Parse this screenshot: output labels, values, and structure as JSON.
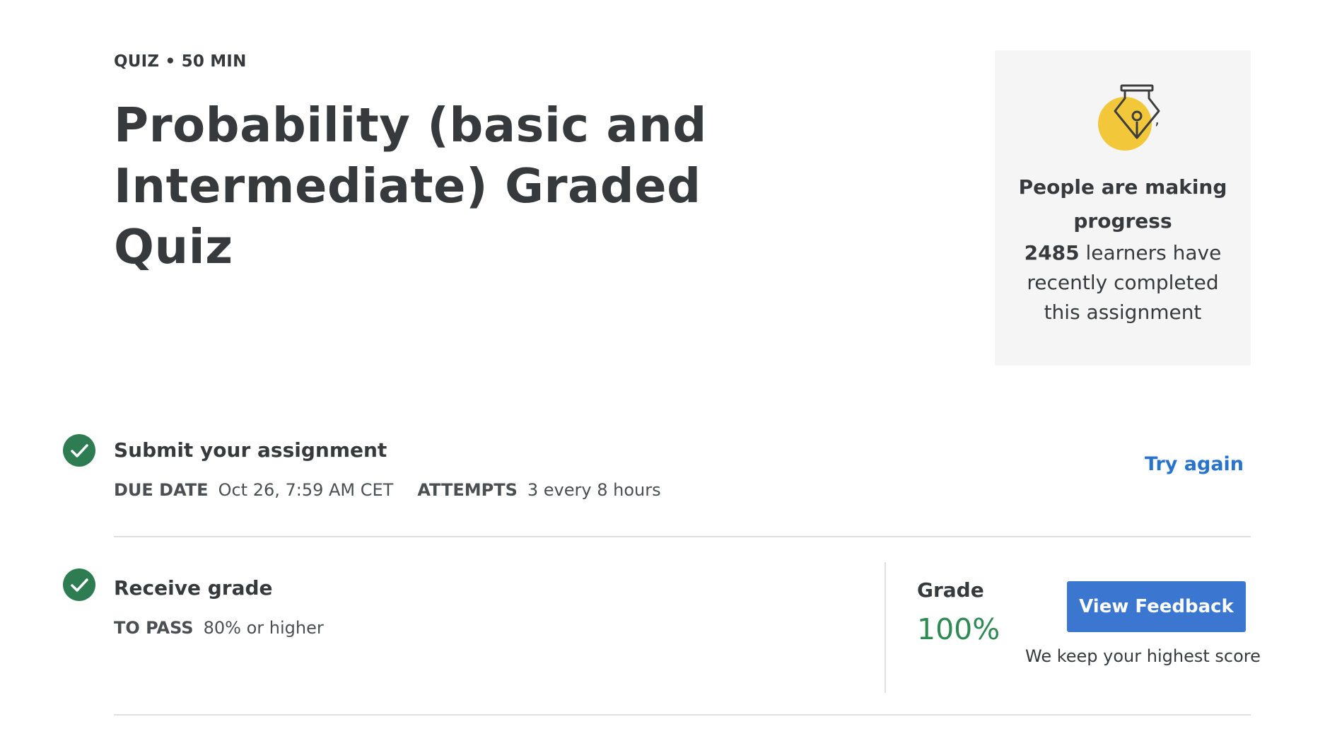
{
  "header": {
    "type_label": "QUIZ",
    "separator": "•",
    "duration": "50 MIN",
    "title_line1": "Probability (basic and",
    "title_line2": "Intermediate) Graded Quiz"
  },
  "progress_card": {
    "icon": "pen-nib-icon",
    "icon_accent": "#f2c83a",
    "trailing_mark": ",",
    "heading": "People are making progress",
    "learner_count": "2485",
    "text_after_count": "learners have recently completed this assignment"
  },
  "submit_step": {
    "title": "Submit your assignment",
    "status_icon": "check-circle-icon",
    "due_label": "DUE DATE",
    "due_value": "Oct 26, 7:59 AM CET",
    "attempts_label": "ATTEMPTS",
    "attempts_value": "3 every 8 hours",
    "try_again": "Try again"
  },
  "grade_step": {
    "title": "Receive grade",
    "status_icon": "check-circle-icon",
    "pass_label": "TO PASS",
    "pass_value": "80% or higher",
    "grade_label": "Grade",
    "grade_value": "100%",
    "view_feedback": "View Feedback",
    "note": "We keep your highest score"
  },
  "colors": {
    "success": "#2e7d52",
    "grade_text": "#2e8a52",
    "link": "#2a73cc",
    "button": "#3b76d0"
  }
}
